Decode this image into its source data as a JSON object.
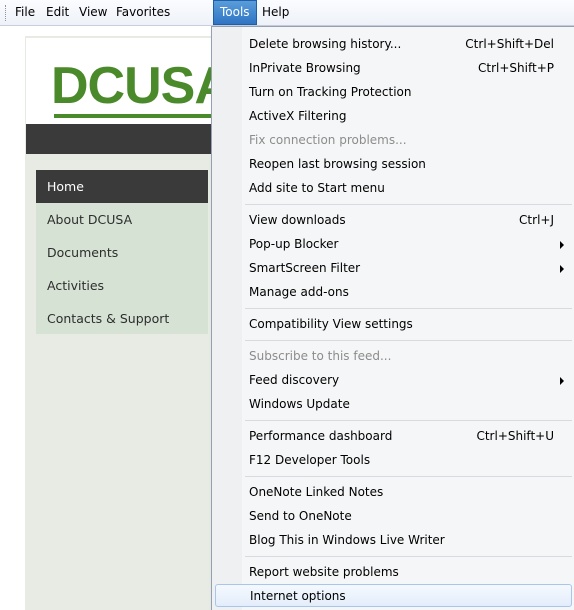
{
  "menubar": {
    "items": [
      "File",
      "Edit",
      "View",
      "Favorites",
      "Tools",
      "Help"
    ],
    "active": "Tools"
  },
  "site": {
    "logo_text": "DCUSA",
    "nav": [
      "Home",
      "About DCUSA",
      "Documents",
      "Activities",
      "Contacts & Support"
    ],
    "active_nav": "Home"
  },
  "tools_menu": {
    "group1": [
      {
        "label": "Delete browsing history...",
        "shortcut": "Ctrl+Shift+Del"
      },
      {
        "label": "InPrivate Browsing",
        "shortcut": "Ctrl+Shift+P"
      },
      {
        "label": "Turn on Tracking Protection",
        "shortcut": ""
      },
      {
        "label": "ActiveX Filtering",
        "shortcut": ""
      },
      {
        "label": "Fix connection problems...",
        "shortcut": "",
        "disabled": true
      },
      {
        "label": "Reopen last browsing session",
        "shortcut": ""
      },
      {
        "label": "Add site to Start menu",
        "shortcut": ""
      }
    ],
    "group2": [
      {
        "label": "View downloads",
        "shortcut": "Ctrl+J"
      },
      {
        "label": "Pop-up Blocker",
        "submenu": true
      },
      {
        "label": "SmartScreen Filter",
        "submenu": true
      },
      {
        "label": "Manage add-ons",
        "shortcut": ""
      }
    ],
    "group3": [
      {
        "label": "Compatibility View settings",
        "shortcut": ""
      }
    ],
    "group4": [
      {
        "label": "Subscribe to this feed...",
        "disabled": true
      },
      {
        "label": "Feed discovery",
        "submenu": true
      },
      {
        "label": "Windows Update",
        "shortcut": ""
      }
    ],
    "group5": [
      {
        "label": "Performance dashboard",
        "shortcut": "Ctrl+Shift+U"
      },
      {
        "label": "F12 Developer Tools",
        "shortcut": ""
      }
    ],
    "group6": [
      {
        "label": "OneNote Linked Notes"
      },
      {
        "label": "Send to OneNote"
      },
      {
        "label": "Blog This in Windows Live Writer"
      }
    ],
    "group7": [
      {
        "label": "Report website problems"
      },
      {
        "label": "Internet options",
        "highlighted": true
      }
    ]
  },
  "colors": {
    "logo_green": "#4a8a2a",
    "nav_bg": "#d6e3d4",
    "dark_bar": "#3a3a3a",
    "menu_highlight": "#2f74c4"
  }
}
